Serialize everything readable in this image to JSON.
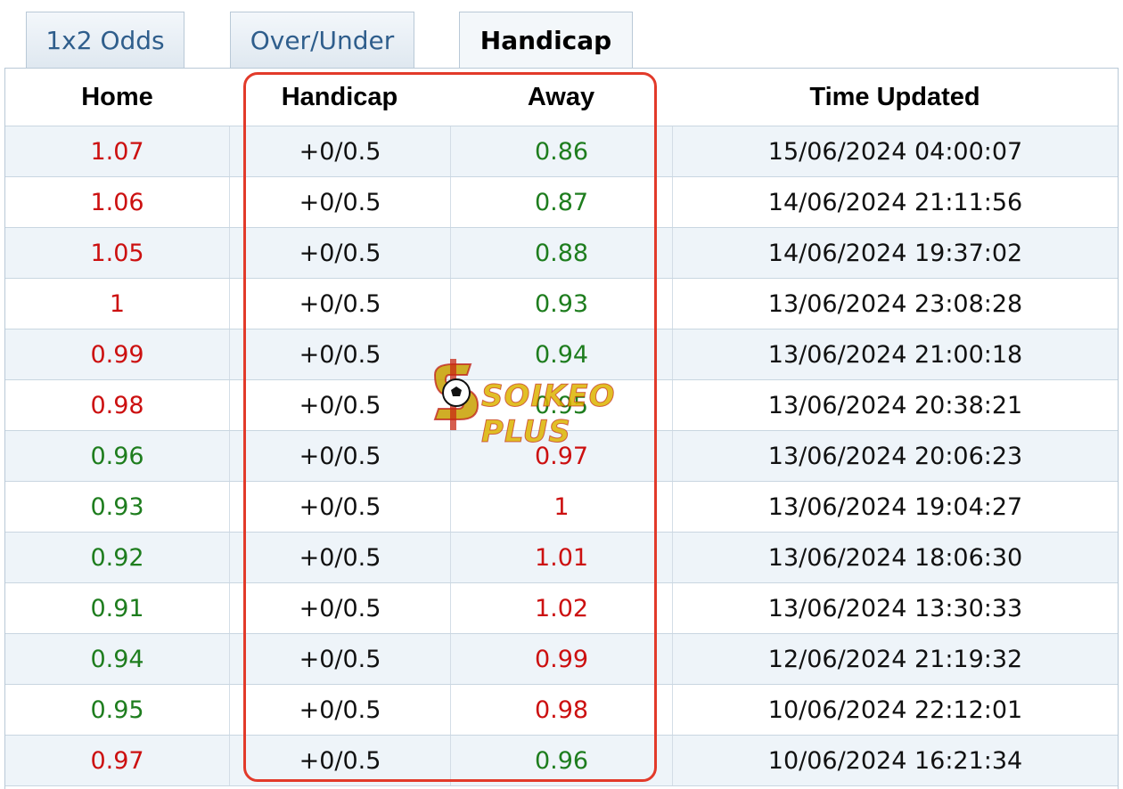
{
  "tabs": [
    {
      "label": "1x2 Odds",
      "active": false
    },
    {
      "label": "Over/Under",
      "active": false
    },
    {
      "label": "Handicap",
      "active": true
    }
  ],
  "columns": [
    "Home",
    "Handicap",
    "Away",
    "Time Updated"
  ],
  "rows": [
    {
      "home": "1.07",
      "handicap": "+0/0.5",
      "away": "0.86",
      "time": "15/06/2024 04:00:07"
    },
    {
      "home": "1.06",
      "handicap": "+0/0.5",
      "away": "0.87",
      "time": "14/06/2024 21:11:56"
    },
    {
      "home": "1.05",
      "handicap": "+0/0.5",
      "away": "0.88",
      "time": "14/06/2024 19:37:02"
    },
    {
      "home": "1",
      "handicap": "+0/0.5",
      "away": "0.93",
      "time": "13/06/2024 23:08:28"
    },
    {
      "home": "0.99",
      "handicap": "+0/0.5",
      "away": "0.94",
      "time": "13/06/2024 21:00:18"
    },
    {
      "home": "0.98",
      "handicap": "+0/0.5",
      "away": "0.95",
      "time": "13/06/2024 20:38:21"
    },
    {
      "home": "0.96",
      "handicap": "+0/0.5",
      "away": "0.97",
      "time": "13/06/2024 20:06:23"
    },
    {
      "home": "0.93",
      "handicap": "+0/0.5",
      "away": "1",
      "time": "13/06/2024 19:04:27"
    },
    {
      "home": "0.92",
      "handicap": "+0/0.5",
      "away": "1.01",
      "time": "13/06/2024 18:06:30"
    },
    {
      "home": "0.91",
      "handicap": "+0/0.5",
      "away": "1.02",
      "time": "13/06/2024 13:30:33"
    },
    {
      "home": "0.94",
      "handicap": "+0/0.5",
      "away": "0.99",
      "time": "12/06/2024 21:19:32"
    },
    {
      "home": "0.95",
      "handicap": "+0/0.5",
      "away": "0.98",
      "time": "10/06/2024 22:12:01"
    },
    {
      "home": "0.97",
      "handicap": "+0/0.5",
      "away": "0.96",
      "time": "10/06/2024 16:21:34"
    }
  ],
  "colors": {
    "odds_up": "#cc1010",
    "odds_down": "#1e7d1e",
    "highlight_border": "#e23a2a",
    "tab_text": "#2f5e8c",
    "row_alt": "#eef4f9"
  },
  "watermark": {
    "text": "SOIKEO PLUS",
    "icon": "soccer-ball-dollar-icon"
  }
}
